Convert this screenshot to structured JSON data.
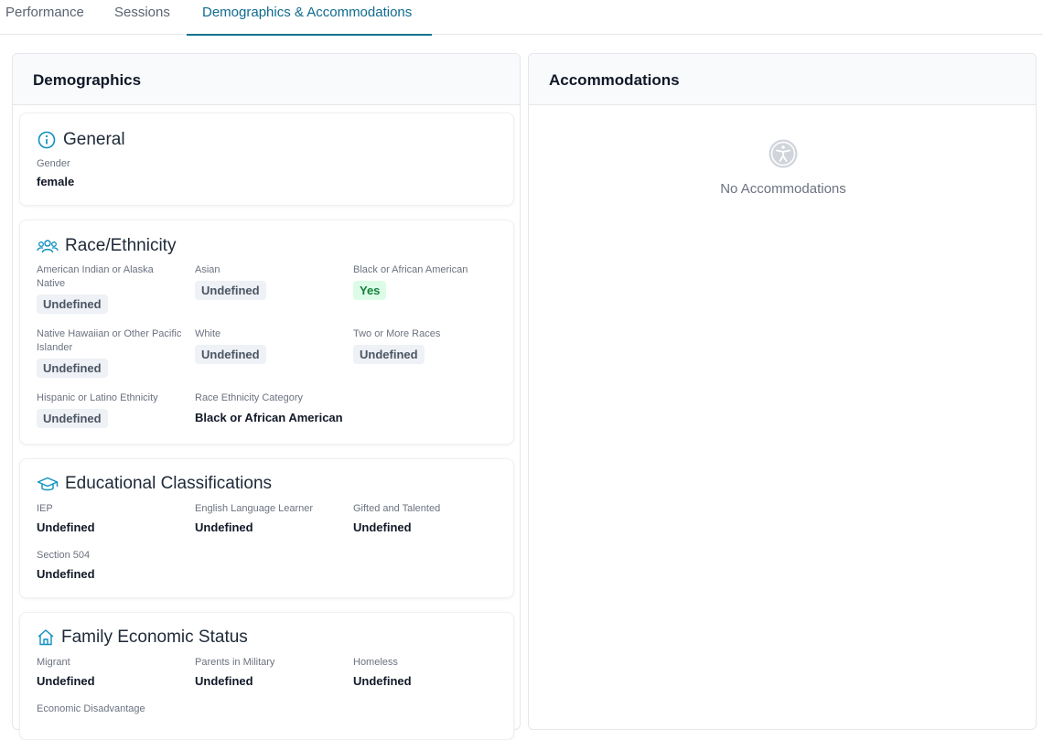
{
  "tabs": [
    {
      "label": "Performance"
    },
    {
      "label": "Sessions"
    },
    {
      "label": "Demographics & Accommodations"
    }
  ],
  "demographics": {
    "title": "Demographics",
    "general": {
      "title": "General",
      "gender_label": "Gender",
      "gender_value": "female"
    },
    "race": {
      "title": "Race/Ethnicity",
      "fields": [
        {
          "label": "American Indian or Alaska Native",
          "value": "Undefined"
        },
        {
          "label": "Asian",
          "value": "Undefined"
        },
        {
          "label": "Black or African American",
          "value": "Yes"
        },
        {
          "label": "Native Hawaiian or Other Pacific Islander",
          "value": "Undefined"
        },
        {
          "label": "White",
          "value": "Undefined"
        },
        {
          "label": "Two or More Races",
          "value": "Undefined"
        },
        {
          "label": "Hispanic or Latino Ethnicity",
          "value": "Undefined"
        },
        {
          "label": "Race Ethnicity Category",
          "value": "Black or African American"
        }
      ]
    },
    "education": {
      "title": "Educational Classifications",
      "fields": [
        {
          "label": "IEP",
          "value": "Undefined"
        },
        {
          "label": "English Language Learner",
          "value": "Undefined"
        },
        {
          "label": "Gifted and Talented",
          "value": "Undefined"
        },
        {
          "label": "Section 504",
          "value": "Undefined"
        }
      ]
    },
    "family": {
      "title": "Family Economic Status",
      "fields": [
        {
          "label": "Migrant",
          "value": "Undefined"
        },
        {
          "label": "Parents in Military",
          "value": "Undefined"
        },
        {
          "label": "Homeless",
          "value": "Undefined"
        },
        {
          "label": "Economic Disadvantage",
          "value": ""
        }
      ]
    }
  },
  "accommodations": {
    "title": "Accommodations",
    "empty_text": "No Accommodations"
  },
  "colors": {
    "accent": "#0e7490",
    "yes_bg": "#dcfce7",
    "yes_text": "#15803d",
    "badge_bg": "#eef1f5"
  }
}
